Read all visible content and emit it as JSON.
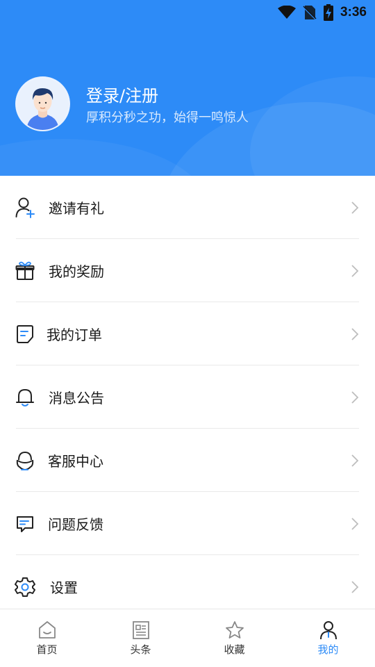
{
  "status_bar": {
    "time": "3:36",
    "icons": [
      "wifi-icon",
      "no-sim-icon",
      "battery-charging-icon"
    ]
  },
  "profile": {
    "avatar": "user-avatar",
    "title": "登录/注册",
    "subtitle": "厚积分秒之功，始得一鸣惊人"
  },
  "menu": {
    "items": [
      {
        "label": "邀请有礼",
        "icon": "invite-user-icon"
      },
      {
        "label": "我的奖励",
        "icon": "gift-icon"
      },
      {
        "label": "我的订单",
        "icon": "order-document-icon"
      },
      {
        "label": "消息公告",
        "icon": "bell-icon"
      },
      {
        "label": "客服中心",
        "icon": "customer-service-icon"
      },
      {
        "label": "问题反馈",
        "icon": "feedback-message-icon"
      },
      {
        "label": "设置",
        "icon": "settings-gear-icon"
      }
    ]
  },
  "tabbar": {
    "active": "我的",
    "tabs": [
      {
        "label": "首页",
        "icon": "home-icon"
      },
      {
        "label": "头条",
        "icon": "news-icon"
      },
      {
        "label": "收藏",
        "icon": "star-icon"
      },
      {
        "label": "我的",
        "icon": "profile-icon"
      }
    ]
  },
  "colors": {
    "accent": "#2d8bf7",
    "header_bg": "#2d8bf7",
    "text": "#1a1a1a",
    "divider": "#e9e9e9"
  }
}
